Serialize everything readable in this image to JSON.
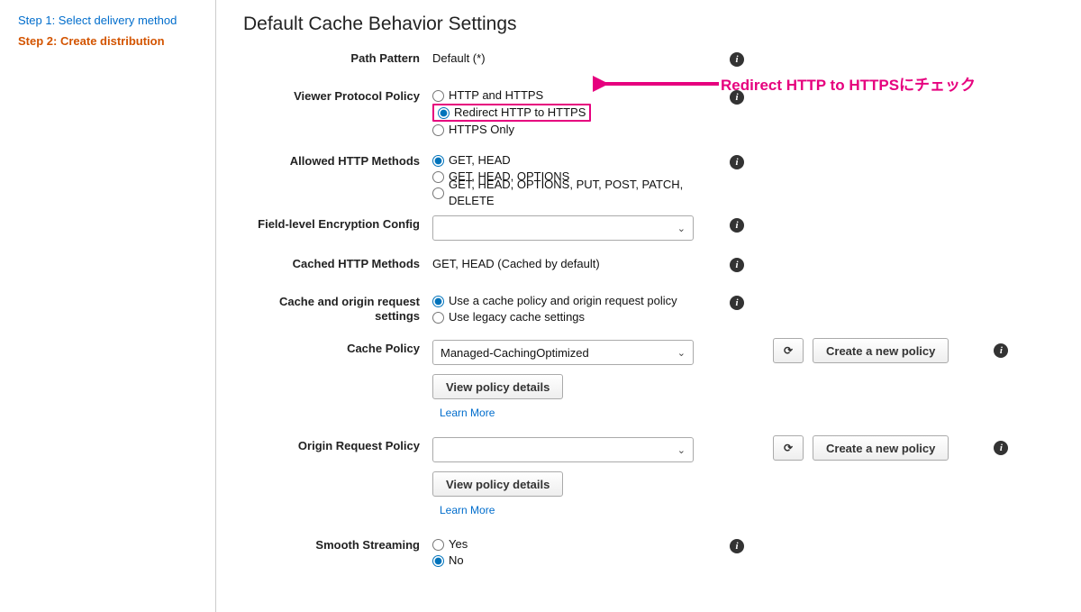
{
  "sidebar": {
    "step1": "Step 1: Select delivery method",
    "step2": "Step 2: Create distribution"
  },
  "title": "Default Cache Behavior Settings",
  "pathPattern": {
    "label": "Path Pattern",
    "value": "Default (*)"
  },
  "viewerProtocol": {
    "label": "Viewer Protocol Policy",
    "opt1": "HTTP and HTTPS",
    "opt2": "Redirect HTTP to HTTPS",
    "opt3": "HTTPS Only"
  },
  "allowedMethods": {
    "label": "Allowed HTTP Methods",
    "opt1": "GET, HEAD",
    "opt2": "GET, HEAD, OPTIONS",
    "opt3": "GET, HEAD, OPTIONS, PUT, POST, PATCH, DELETE"
  },
  "fieldEncryption": {
    "label": "Field-level Encryption Config",
    "placeholder": ""
  },
  "cachedMethods": {
    "label": "Cached HTTP Methods",
    "value": "GET, HEAD (Cached by default)"
  },
  "cacheOrigin": {
    "label1": "Cache and origin request",
    "label2": "settings",
    "opt1": "Use a cache policy and origin request policy",
    "opt2": "Use legacy cache settings"
  },
  "cachePolicy": {
    "label": "Cache Policy",
    "selected": "Managed-CachingOptimized",
    "viewDetails": "View policy details",
    "learnMore": "Learn More",
    "create": "Create a new policy"
  },
  "originRequest": {
    "label": "Origin Request Policy",
    "selected": "",
    "viewDetails": "View policy details",
    "learnMore": "Learn More",
    "create": "Create a new policy"
  },
  "smooth": {
    "label": "Smooth Streaming",
    "yes": "Yes",
    "no": "No"
  },
  "annotation": "Redirect HTTP to HTTPSにチェック",
  "icons": {
    "info": "i",
    "refresh": "⟳",
    "chevron": "⌄"
  }
}
